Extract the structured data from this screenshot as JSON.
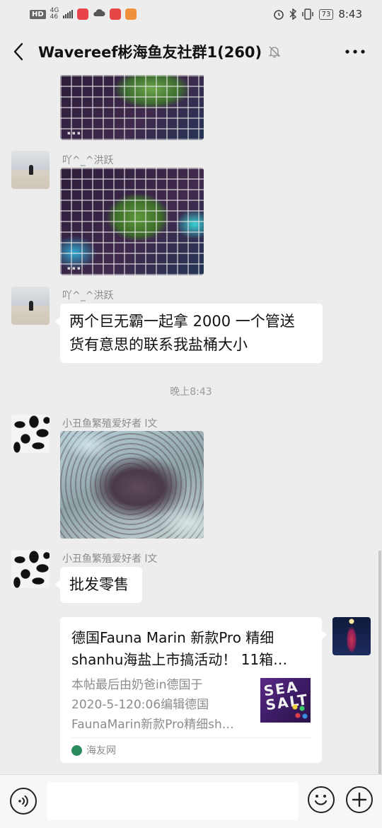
{
  "status_bar": {
    "left_badge": "HD",
    "network_type": "4G",
    "network_speed": "46",
    "time": "8:43",
    "battery": "73"
  },
  "chat": {
    "title": "Wavereef彬海鱼友社群1(260)"
  },
  "messages": [
    {
      "type": "image",
      "sender": ""
    },
    {
      "type": "image",
      "sender": "吖^_^洪跃"
    },
    {
      "type": "text",
      "sender": "吖^_^洪跃",
      "text_line1": "两个巨无霸一起拿 2000 一个管送",
      "text_line2": "货有意思的联系我盐桶大小"
    },
    {
      "type": "time",
      "text": "晚上8:43"
    },
    {
      "type": "image",
      "sender": "小丑鱼繁殖爱好者 l文"
    },
    {
      "type": "text",
      "sender": "小丑鱼繁殖爱好者 l文",
      "text": "批发零售"
    },
    {
      "type": "link",
      "title_line1": "德国Fauna Marin 新款Pro 精细",
      "title_line2": "shanhu海盐上市搞活动！ 11箱…",
      "desc_line1": "本帖最后由奶爸in德国于",
      "desc_line2": "2020-5-120:06编辑德国",
      "desc_line3": "FaunaMarin新款Pro精细sh…",
      "thumb_text": "SEA SALT",
      "source": "海友网"
    }
  ],
  "icons": {
    "back": "chevron-left-icon",
    "mute": "bell-off-icon",
    "more": "more-horizontal-icon",
    "voice": "voice-icon",
    "emoji": "emoji-icon",
    "plus": "plus-icon"
  },
  "colors": {
    "background": "#ededed",
    "bubble": "#ffffff",
    "muted_text": "#8a8a8a"
  }
}
